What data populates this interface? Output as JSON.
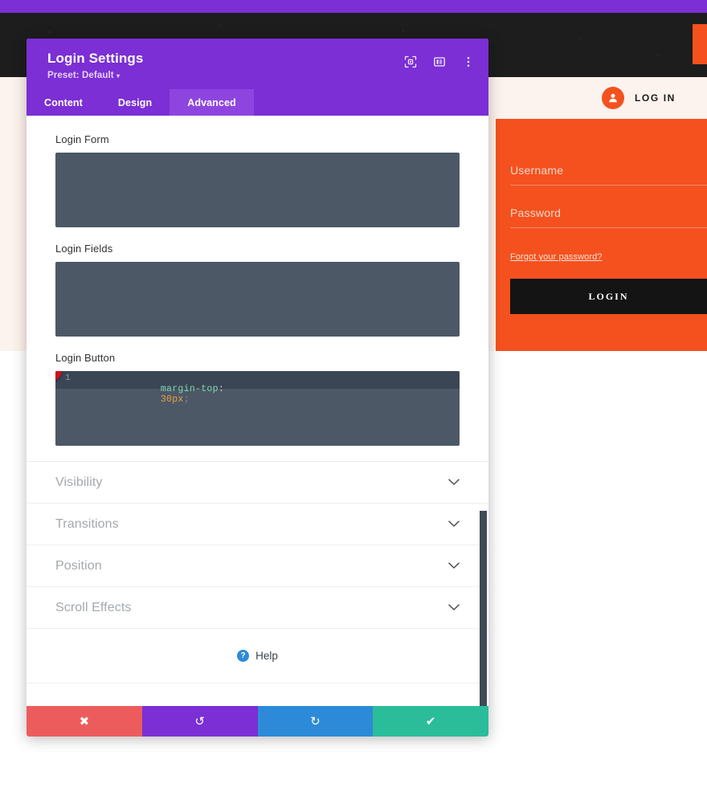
{
  "page": {
    "background_dark": "#1d1d1d",
    "accent_purple": "#7b2fd4",
    "accent_orange": "#f4511e"
  },
  "login_widget": {
    "header_label": "LOG IN",
    "avatar_icon": "user-circle-icon",
    "username_label": "Username",
    "password_label": "Password",
    "forgot_link": "Forgot your password?",
    "submit_label": "LOGIN"
  },
  "modal": {
    "title": "Login Settings",
    "preset": "Preset: Default",
    "preset_caret": "▾",
    "header_icons": [
      {
        "name": "focus-target-icon"
      },
      {
        "name": "layout-panel-icon"
      },
      {
        "name": "more-vertical-icon"
      }
    ],
    "tabs": [
      {
        "label": "Content",
        "active": false
      },
      {
        "label": "Design",
        "active": false
      },
      {
        "label": "Advanced",
        "active": true
      }
    ],
    "fields": [
      {
        "label": "Login Form",
        "code": null
      },
      {
        "label": "Login Fields",
        "code": null
      },
      {
        "label": "Login Button",
        "badge": "1",
        "code": {
          "line_number": "1",
          "property": "margin-top",
          "colon": ":",
          "value": "30px",
          "semicolon": ";"
        }
      }
    ],
    "accordions": [
      {
        "label": "Visibility",
        "chevron": "⌄"
      },
      {
        "label": "Transitions",
        "chevron": "⌄"
      },
      {
        "label": "Position",
        "chevron": "⌄"
      },
      {
        "label": "Scroll Effects",
        "chevron": "⌄"
      }
    ],
    "help": {
      "icon_text": "?",
      "label": "Help"
    },
    "footer_buttons": [
      {
        "name": "cancel-button",
        "glyph": "✖",
        "color": "#ec5c5c"
      },
      {
        "name": "undo-button",
        "glyph": "↺",
        "color": "#7b2fd4"
      },
      {
        "name": "redo-button",
        "glyph": "↻",
        "color": "#2d8ad8"
      },
      {
        "name": "save-button",
        "glyph": "✔",
        "color": "#2bbd9a"
      }
    ]
  }
}
